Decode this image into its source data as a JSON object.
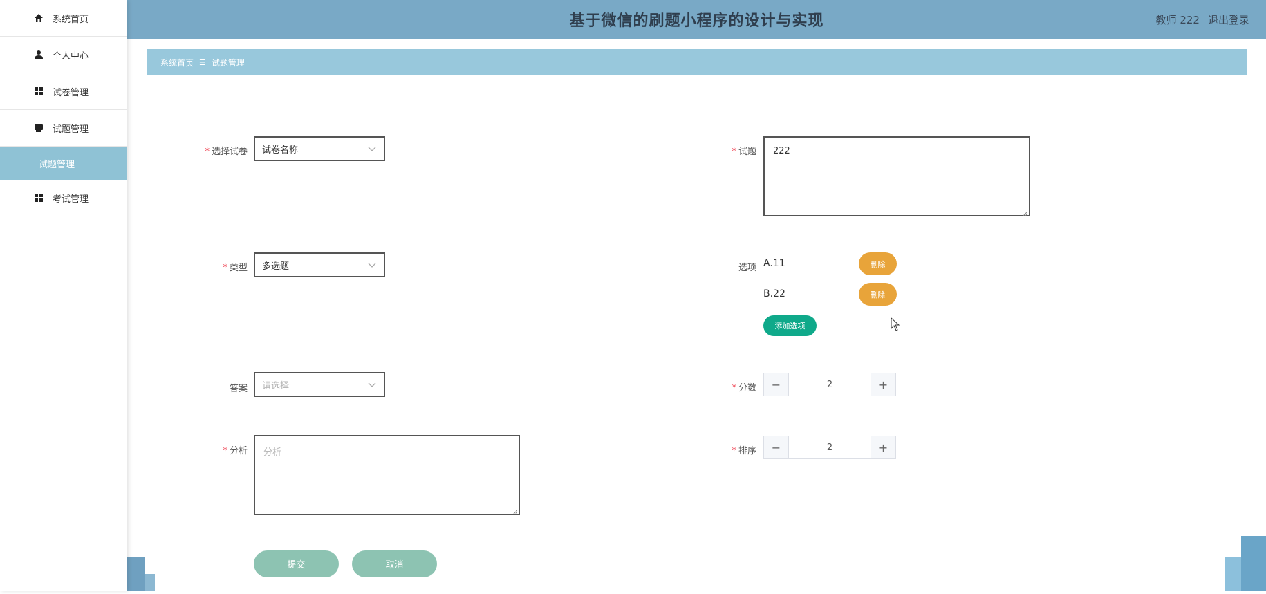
{
  "header": {
    "title": "基于微信的刷题小程序的设计与实现",
    "user_label": "教师 222",
    "logout_label": "退出登录"
  },
  "sidebar": {
    "items": [
      {
        "label": "系统首页",
        "icon": "home-icon"
      },
      {
        "label": "个人中心",
        "icon": "person-icon"
      },
      {
        "label": "试卷管理",
        "icon": "grid-icon"
      },
      {
        "label": "试题管理",
        "icon": "printer-icon"
      },
      {
        "label": "考试管理",
        "icon": "grid-icon"
      }
    ],
    "active_sub": "试题管理"
  },
  "breadcrumb": {
    "home": "系统首页",
    "separator": "☰",
    "current": "试题管理"
  },
  "form": {
    "paper": {
      "label": "选择试卷",
      "value": "试卷名称"
    },
    "question": {
      "label": "试题",
      "value": "222"
    },
    "type": {
      "label": "类型",
      "value": "多选题"
    },
    "options": {
      "label": "选项",
      "items": [
        {
          "text": "A.11",
          "delete_label": "删除"
        },
        {
          "text": "B.22",
          "delete_label": "删除"
        }
      ],
      "add_label": "添加选项"
    },
    "answer": {
      "label": "答案",
      "placeholder": "请选择"
    },
    "score": {
      "label": "分数",
      "value": "2"
    },
    "analysis": {
      "label": "分析",
      "placeholder": "分析"
    },
    "order": {
      "label": "排序",
      "value": "2"
    },
    "submit_label": "提交",
    "cancel_label": "取消"
  },
  "colors": {
    "header": "#79a9c6",
    "breadcrumb": "#98c8dc",
    "active_sub": "#8fc2d5",
    "delete": "#e8a43a",
    "add": "#0fa98a",
    "pill": "#8dc3b2"
  }
}
